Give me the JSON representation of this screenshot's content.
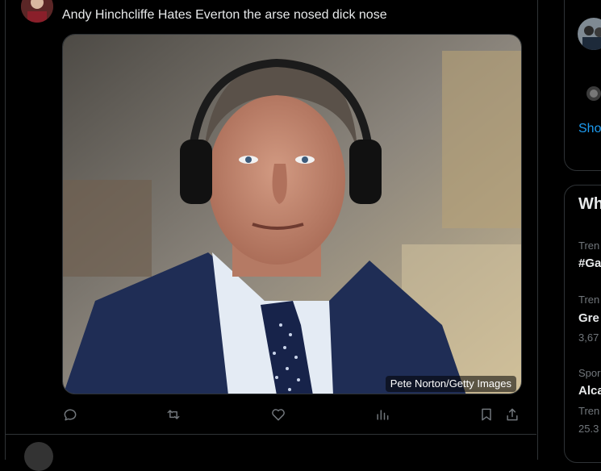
{
  "tweet": {
    "text": "Andy Hinchcliffe Hates Everton the arse nosed dick nose",
    "media_credit": "Pete Norton/Getty Images"
  },
  "actions": [
    {
      "name": "reply-button",
      "icon": "reply-icon"
    },
    {
      "name": "repost-button",
      "icon": "repost-icon"
    },
    {
      "name": "like-button",
      "icon": "heart-icon"
    },
    {
      "name": "views-button",
      "icon": "analytics-icon"
    },
    {
      "name": "bookmark-button",
      "icon": "bookmark-icon"
    },
    {
      "name": "share-button",
      "icon": "share-icon"
    }
  ],
  "sidebar": {
    "follow_card": {
      "show_more": "Sho"
    },
    "trends_card": {
      "title": "Wh",
      "items": [
        {
          "meta": "Tren",
          "topic": "#Ga",
          "count": ""
        },
        {
          "meta": "Tren",
          "topic": "Gre",
          "count": "3,67"
        },
        {
          "meta": "Spor",
          "topic": "Alca",
          "count": ""
        },
        {
          "meta": "Tren",
          "topic": "",
          "count": "25.3"
        }
      ]
    }
  },
  "colors": {
    "background": "#000000",
    "border": "#2f3336",
    "text_primary": "#e7e9ea",
    "text_secondary": "#71767b",
    "accent": "#1d9bf0"
  }
}
